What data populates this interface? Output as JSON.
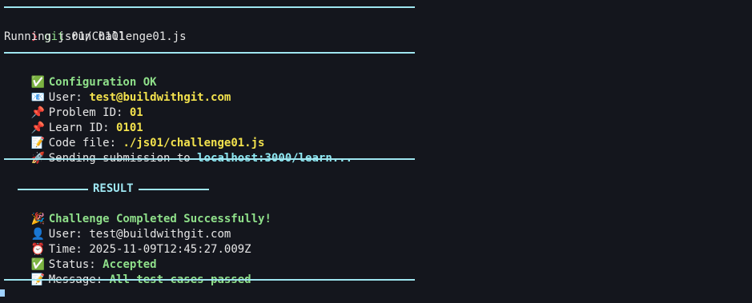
{
  "prompt": {
    "arrow": "❯",
    "command": "git",
    "args": "run 0101"
  },
  "running_line": "Running js01/Challenge01.js",
  "config": {
    "ok": {
      "icon": "check-icon",
      "glyph": "✅",
      "text": "Configuration OK"
    },
    "user": {
      "icon": "envelope-icon",
      "glyph": "📧",
      "label": "User:",
      "value": "test@buildwithgit.com"
    },
    "problem_id": {
      "icon": "pushpin-icon",
      "glyph": "📌",
      "label": "Problem ID:",
      "value": "01"
    },
    "learn_id": {
      "icon": "pushpin-icon",
      "glyph": "📌",
      "label": "Learn ID:",
      "value": "0101"
    },
    "code_file": {
      "icon": "memo-icon",
      "glyph": "📝",
      "label": "Code file:",
      "value": "./js01/challenge01.js"
    },
    "sending": {
      "icon": "rocket-icon",
      "glyph": "🚀",
      "label": "Sending submission to",
      "value": "localhost:3000/learn..."
    }
  },
  "result": {
    "header": "RESULT",
    "completed": {
      "icon": "party-popper-icon",
      "glyph": "🎉",
      "text": "Challenge Completed Successfully!"
    },
    "user": {
      "icon": "user-silhouette-icon",
      "glyph": "👤",
      "label": "User:",
      "value": "test@buildwithgit.com"
    },
    "time": {
      "icon": "alarm-clock-icon",
      "glyph": "⏰",
      "label": "Time:",
      "value": "2025-11-09T12:45:27.009Z"
    },
    "status": {
      "icon": "check-icon",
      "glyph": "✅",
      "label": "Status:",
      "value": "Accepted"
    },
    "message": {
      "icon": "memo-icon",
      "glyph": "📝",
      "label": "Message:",
      "value": "All test cases passed"
    }
  },
  "colors": {
    "background": "#14161d",
    "rule": "#9fe6f0",
    "green": "#8fe08a",
    "yellow": "#f3e24d",
    "cyan": "#8ee8f2",
    "prompt_arrow": "#e64553"
  }
}
